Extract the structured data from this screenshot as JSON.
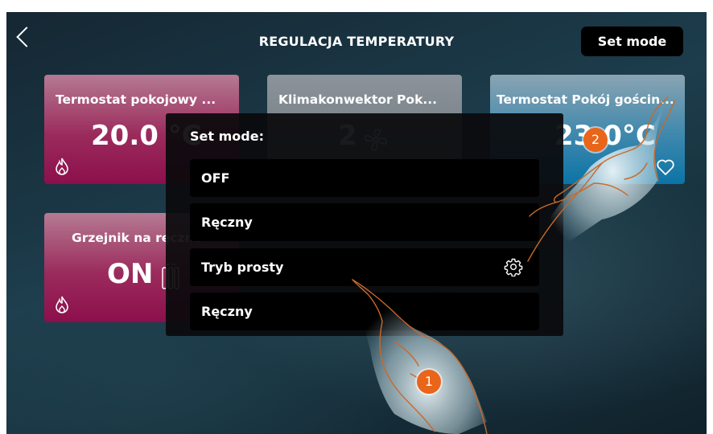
{
  "header": {
    "title": "REGULACJA TEMPERATURY",
    "set_mode_label": "Set mode"
  },
  "tiles": [
    {
      "name": "Termostat pokojowy ...",
      "value": "20.0 °C",
      "icon": "flame-icon",
      "color": "#9b2b5c"
    },
    {
      "name": "Klimakonwektor Pok...",
      "value": "2",
      "icon": "fan-icon",
      "color": "#6a7378"
    },
    {
      "name": "Termostat Pokój gościn...",
      "value": "23.0°C",
      "icon": "heart-icon",
      "color": "#0b74a6"
    },
    {
      "name": "Grzejnik na ręczne",
      "value": "ON",
      "icon": "radiator-icon",
      "icon2": "flame-icon",
      "color": "#9b2b5c"
    }
  ],
  "dialog": {
    "title": "Set mode:",
    "options": [
      {
        "label": "OFF"
      },
      {
        "label": "Ręczny"
      },
      {
        "label": "Tryb prosty",
        "icon": "gear-icon"
      },
      {
        "label": "Ręczny"
      }
    ]
  },
  "annotations": {
    "marker1": "1",
    "marker2": "2",
    "accent_color": "#e8651a"
  }
}
